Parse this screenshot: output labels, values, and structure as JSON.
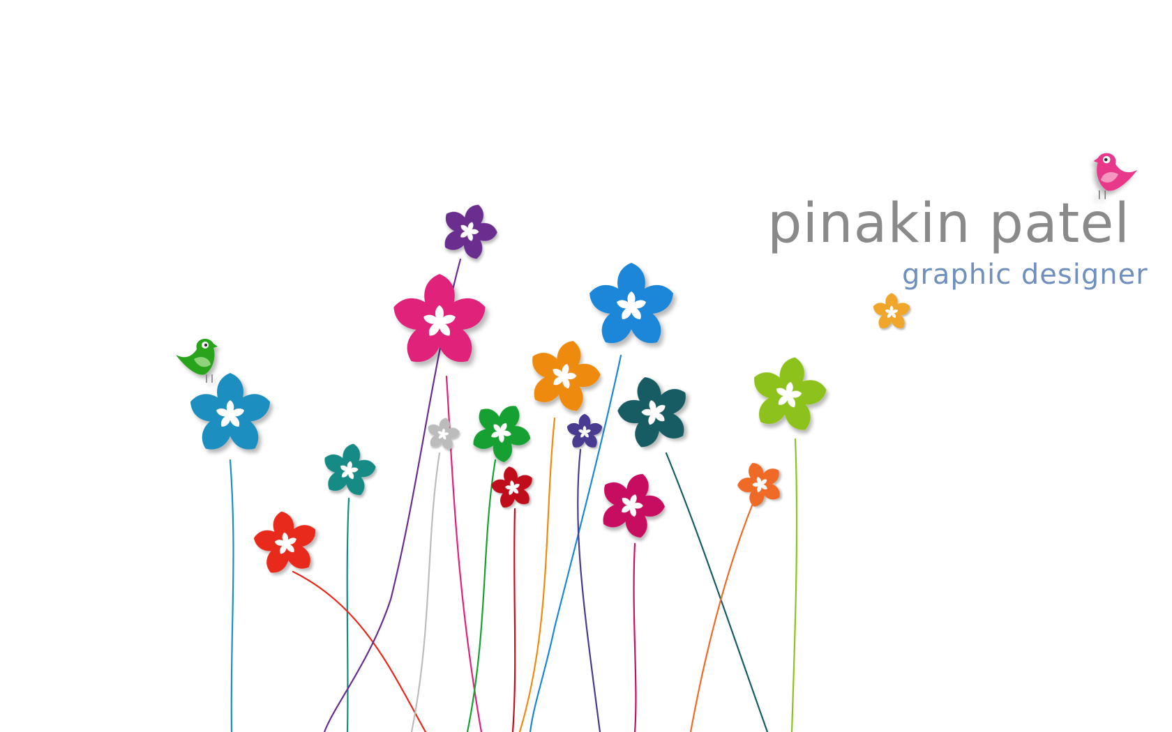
{
  "signature": {
    "name": "pinakin patel",
    "title": "graphic designer"
  },
  "colors": {
    "background": "#ffffff",
    "name_text": "#8a8a8a",
    "title_text": "#6f8fbe"
  },
  "icons": [
    "flower-icon",
    "bird-icon"
  ]
}
